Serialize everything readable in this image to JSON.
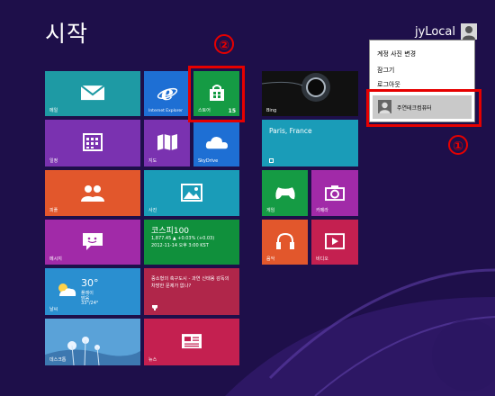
{
  "start_title": "시작",
  "user": {
    "name": "jyLocal"
  },
  "account_menu": {
    "items": [
      "계정 사진 변경",
      "잠그기",
      "로그아웃"
    ],
    "selected_user": "주연테크컴퓨터"
  },
  "annotations": {
    "marker_1": "①",
    "marker_2": "②"
  },
  "tiles": {
    "mail": "메일",
    "ie": "Internet Explorer",
    "store": "스토어",
    "store_badge": "15",
    "bing": "Bing",
    "calendar": "일정",
    "maps": "지도",
    "skydrive": "SkyDrive",
    "weather_app_label": "Paris, France",
    "people": "피플",
    "photos": "사진",
    "games": "게임",
    "camera": "카메라",
    "messaging": "메시지",
    "finance_title": "코스피100",
    "finance_line1": "1,877.45  ▲ +0.03% (+0.03)",
    "finance_line2": "2012-11-14 오후 3:00 KST",
    "music": "음악",
    "video": "비디오",
    "weather_temp": "30°",
    "weather_city": "플레이",
    "weather_cond": "맑음",
    "weather_range": "33°/24°",
    "weather_label": "날씨",
    "news_text": "중소형의 축구도시 - 과연 신태용 감독의 차방한 문제가 없나?",
    "desktop": "데스크톱",
    "news": "뉴스"
  },
  "colors": {
    "background": "#1e0f4a",
    "highlight": "#e60000"
  }
}
